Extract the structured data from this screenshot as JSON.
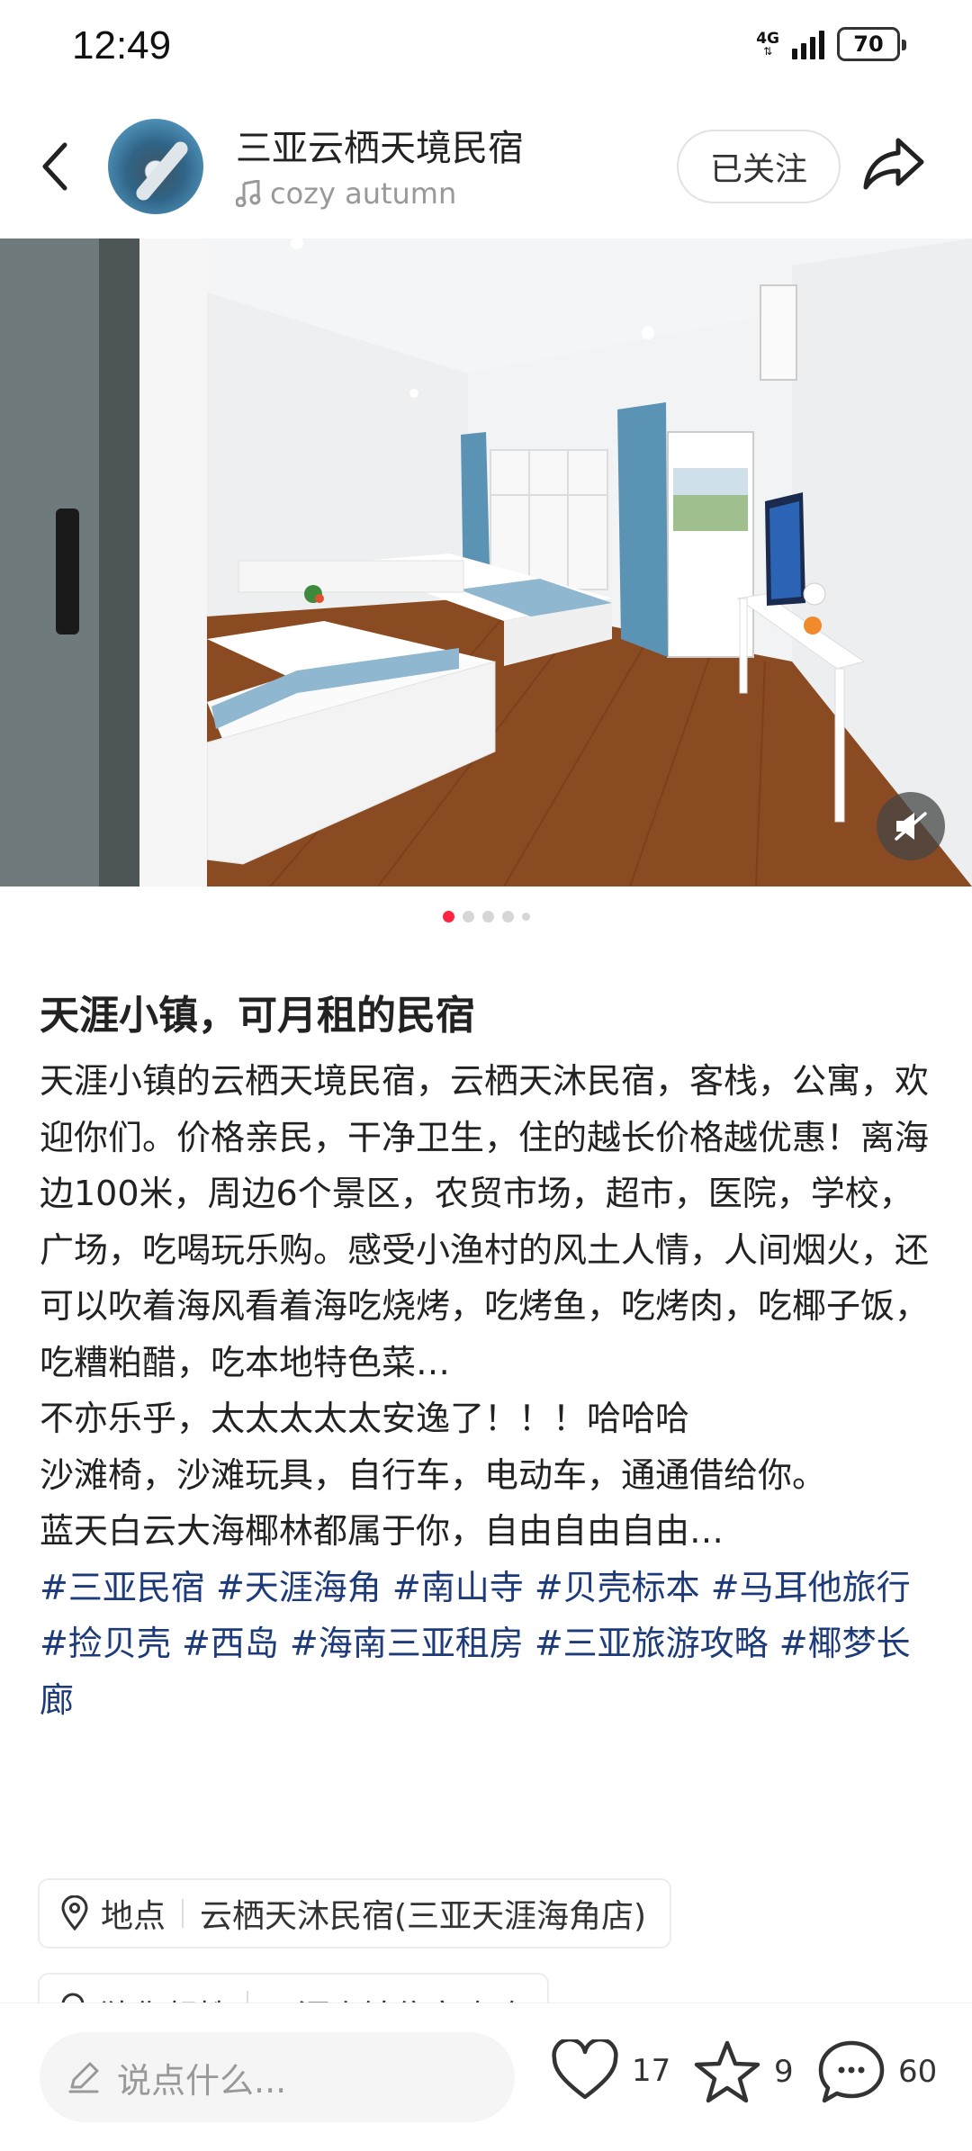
{
  "status_bar": {
    "time": "12:49",
    "network": "4G",
    "battery": "70"
  },
  "header": {
    "author_name": "三亚云栖天境民宿",
    "music": "cozy autumn",
    "follow_label": "已关注"
  },
  "carousel": {
    "total_images": 5,
    "current_index": 1
  },
  "post": {
    "title": "天涯小镇，可月租的民宿",
    "paragraphs": [
      "天涯小镇的云栖天境民宿，云栖天沐民宿，客栈，公寓，欢迎你们。价格亲民，干净卫生，住的越长价格越优惠！离海边100米，周边6个景区，农贸市场，超市，医院，学校，广场，吃喝玩乐购。感受小渔村的风土人情，人间烟火，还可以吹着海风看着海吃烧烤，吃烤鱼，吃烤肉，吃椰子饭，吃糟粕醋，吃本地特色菜…",
      "不亦乐乎，太太太太太安逸了！！！哈哈哈",
      "沙滩椅，沙滩玩具，自行车，电动车，通通借给你。",
      "蓝天白云大海椰林都属于你，自由自由自由…"
    ],
    "tags": [
      "#三亚民宿",
      "#天涯海角",
      "#南山寺",
      "#贝壳标本",
      "#马耳他旅行",
      "#捡贝壳",
      "#西岛",
      "#海南三亚租房",
      "#三亚旅游攻略",
      "#椰梦长廊"
    ]
  },
  "location_chip": {
    "label": "地点",
    "value": "云栖天沐民宿(三亚天涯海角店)",
    "icon": "location-pin-icon"
  },
  "guess_chip": {
    "label": "猜你想搜",
    "value": "天涯小镇住宿攻略",
    "icon": "search-icon"
  },
  "bottom_bar": {
    "comment_placeholder": "说点什么...",
    "likes": "17",
    "stars": "9",
    "comments": "60"
  },
  "colors": {
    "accent": "#ff2442",
    "tag": "#1d3a7a"
  }
}
